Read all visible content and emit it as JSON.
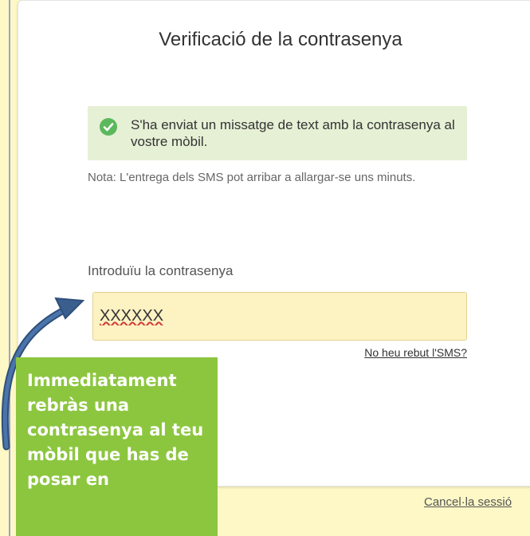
{
  "page": {
    "title": "Verificació de la contrasenya"
  },
  "success_message": {
    "icon": "check-circle-icon",
    "text": "S'ha enviat un missatge de text amb la contrasenya al vostre mòbil."
  },
  "note": "Nota: L'entrega dels SMS pot arribar a allargar-se uns minuts.",
  "password_field": {
    "label": "Introduïu la contrasenya",
    "value": "XXXXXX"
  },
  "no_sms_link": "No heu rebut l'SMS?",
  "cancel_link": "Cancel·la sessió",
  "callout": {
    "text": "Immediatament rebràs una contrasenya al teu mòbil que has de posar en"
  },
  "colors": {
    "background": "#fdf8c6",
    "success_bg": "#e6f0d5",
    "check_green": "#5cb85c",
    "callout_green": "#8cc63f",
    "arrow_blue": "#3a5f8f"
  }
}
